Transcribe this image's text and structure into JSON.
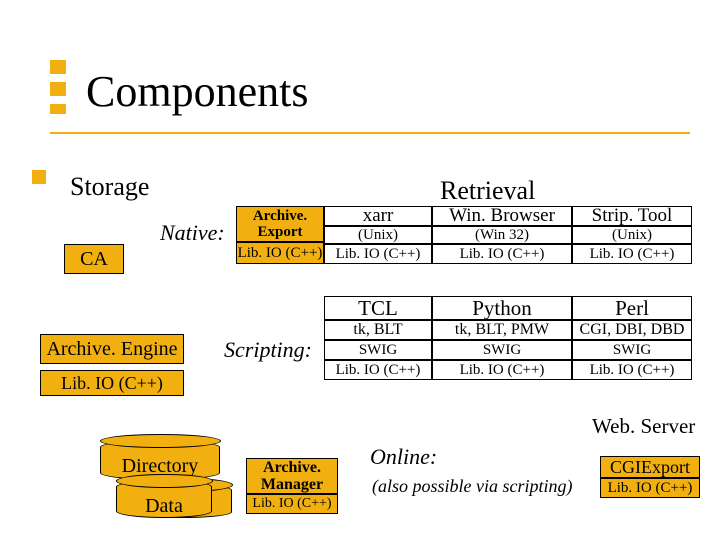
{
  "title": "Components",
  "storage": {
    "heading": "Storage",
    "native_label": "Native:",
    "ca": "CA",
    "engine": "Archive. Engine",
    "libio": "Lib. IO (C++)",
    "directory": "Directory",
    "data": "Data"
  },
  "retrieval": {
    "heading": "Retrieval",
    "archive_export": "Archive. Export",
    "libio": "Lib. IO (C++)",
    "cols": {
      "c1": {
        "tool": "xarr",
        "platform": "(Unix)",
        "lib": "Lib. IO (C++)"
      },
      "c2": {
        "tool": "Win. Browser",
        "platform": "(Win 32)",
        "lib": "Lib. IO (C++)"
      },
      "c3": {
        "tool": "Strip. Tool",
        "platform": "(Unix)",
        "lib": "Lib. IO (C++)"
      }
    }
  },
  "scripting": {
    "label": "Scripting:",
    "cols": {
      "c1": {
        "lang": "TCL",
        "tk": "tk, BLT",
        "swig": "SWIG",
        "lib": "Lib. IO (C++)"
      },
      "c2": {
        "lang": "Python",
        "tk": "tk, BLT, PMW",
        "swig": "SWIG",
        "lib": "Lib. IO (C++)"
      },
      "c3": {
        "lang": "Perl",
        "tk": "CGI, DBI, DBD",
        "swig": "SWIG",
        "lib": "Lib. IO (C++)"
      }
    }
  },
  "online": {
    "label": "Online:",
    "note": "(also possible via scripting)",
    "webserver": "Web. Server",
    "manager": "Archive. Manager",
    "manager_lib": "Lib. IO (C++)",
    "cgi": "CGIExport",
    "cgi_lib": "Lib. IO (C++)"
  }
}
